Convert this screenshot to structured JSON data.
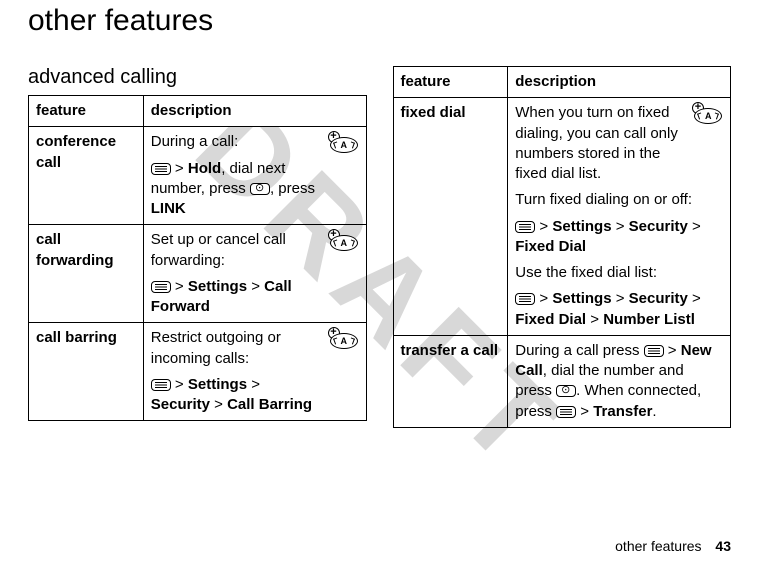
{
  "watermark": "DRAFT",
  "pageTitle": "other features",
  "sectionHeading": "advanced calling",
  "tableHeader": {
    "feature": "feature",
    "description": "description"
  },
  "left": {
    "rows": [
      {
        "feature": "conference call",
        "hasBadge": true,
        "d1": "During a call:",
        "menu1": true,
        "after1a": " > ",
        "b1": "Hold",
        "after1b": ", dial next number, press ",
        "send1": true,
        "after1c": ", press ",
        "b2": "LINK"
      },
      {
        "feature": "call forwarding",
        "hasBadge": true,
        "d1": "Set up or cancel call forwarding:",
        "menu1": true,
        "after1a": " > ",
        "b1": "Settings",
        "after1b": " > ",
        "b2": "Call Forward"
      },
      {
        "feature": "call barring",
        "hasBadge": true,
        "d1": "Restrict outgoing or incoming calls:",
        "menu1": true,
        "after1a": " > ",
        "b1": "Settings",
        "after1b": " > ",
        "b2": "Security",
        "cont": " > ",
        "b3": "Call Barring"
      }
    ]
  },
  "right": {
    "rows": [
      {
        "feature": "fixed dial",
        "hasBadge": true,
        "d1": "When you turn on fixed dialing, you can call only numbers stored in the fixed dial list.",
        "d2": "Turn fixed dialing on or off:",
        "menu1": true,
        "after1a": " > ",
        "b1": "Settings",
        "after1b": " > ",
        "b2": "Security",
        "cont1": " > ",
        "b3": "Fixed Dial",
        "d3": "Use the fixed dial list:",
        "menu2": true,
        "after2a": " > ",
        "b4": "Settings",
        "after2b": " > ",
        "b5": "Security",
        "after2c": " > ",
        "b6": "Fixed Dial",
        "after2d": " > ",
        "b7": "Number Listl"
      },
      {
        "feature": "transfer a call",
        "hasBadge": false,
        "pre": "During a call press ",
        "menu1": true,
        "after1a": " > ",
        "b1": "New Call",
        "after1b": ", dial the number and press ",
        "send1": true,
        "after1c": ". When connected, press ",
        "menu2": true,
        "after2a": " > ",
        "b2": "Transfer",
        "after2b": "."
      }
    ]
  },
  "footer": {
    "text": "other features",
    "page": "43"
  }
}
